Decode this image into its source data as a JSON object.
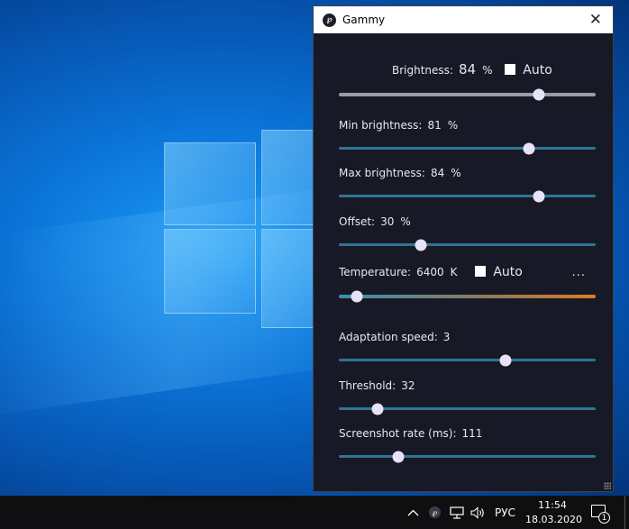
{
  "window": {
    "title": "Gammy",
    "app_icon_glyph": "℘"
  },
  "brightness": {
    "label": "Brightness:",
    "value": "84",
    "unit": "%",
    "auto_label": "Auto",
    "auto_checked": false,
    "slider": 0.78
  },
  "min_brightness": {
    "label": "Min brightness:",
    "value": "81",
    "unit": "%",
    "slider": 0.74
  },
  "max_brightness": {
    "label": "Max brightness:",
    "value": "84",
    "unit": "%",
    "slider": 0.78
  },
  "offset": {
    "label": "Offset:",
    "value": "30",
    "unit": "%",
    "slider": 0.32
  },
  "temperature": {
    "label": "Temperature:",
    "value": "6400",
    "unit": "K",
    "auto_label": "Auto",
    "auto_checked": false,
    "more_label": "...",
    "slider": 0.07
  },
  "adaptation_speed": {
    "label": "Adaptation speed:",
    "value": "3",
    "slider": 0.65
  },
  "threshold": {
    "label": "Threshold:",
    "value": "32",
    "slider": 0.15
  },
  "screenshot_rate": {
    "label": "Screenshot rate (ms):",
    "value": "111",
    "slider": 0.23
  },
  "taskbar": {
    "language": "РУС",
    "time": "11:54",
    "date": "18.03.2020",
    "notification_count": "1",
    "chevron": "^"
  }
}
